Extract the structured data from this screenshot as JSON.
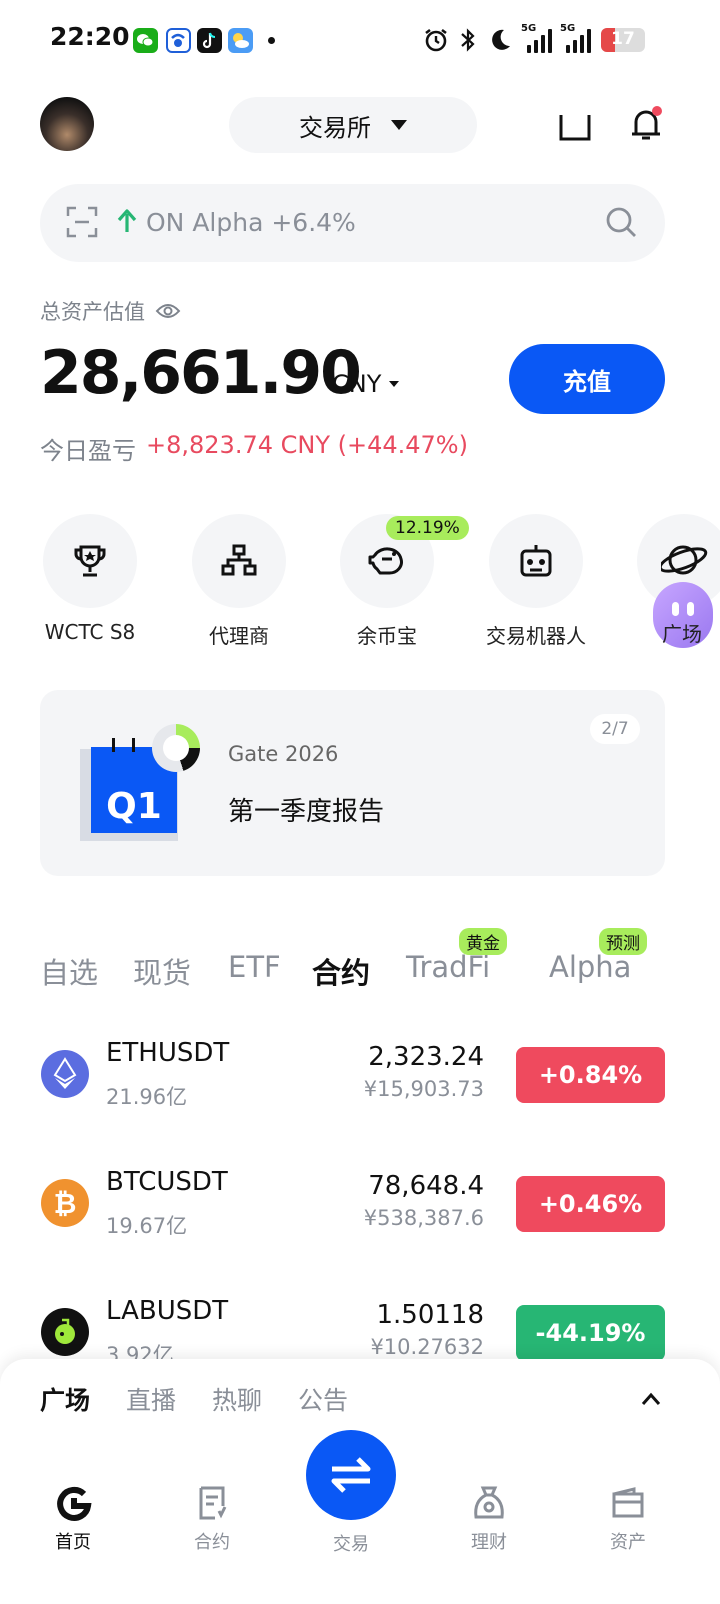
{
  "status_bar": {
    "time": "22:20",
    "battery": "17",
    "net1": "5G",
    "net2": "5G",
    "icons": [
      "wechat-icon",
      "app-icon",
      "tiktok-icon",
      "weather-icon",
      "alarm-icon",
      "bluetooth-icon",
      "moon-icon"
    ]
  },
  "header": {
    "exchange_label": "交易所",
    "icons": [
      "avatar",
      "square-icon",
      "bell-icon"
    ]
  },
  "search": {
    "text": "ON Alpha +6.4%"
  },
  "assets": {
    "label": "总资产估值",
    "value": "28,661.90",
    "unit": "CNY",
    "deposit_label": "充值",
    "pnl_label": "今日盈亏",
    "pnl_value": "+8,823.74 CNY (+44.47%)"
  },
  "shortcuts": [
    {
      "label": "WCTC S8",
      "icon": "trophy-icon"
    },
    {
      "label": "代理商",
      "icon": "org-chart-icon"
    },
    {
      "label": "余币宝",
      "icon": "piggy-bank-icon",
      "badge": "12.19%"
    },
    {
      "label": "交易机器人",
      "icon": "robot-icon"
    },
    {
      "label": "广场",
      "icon": "planet-icon"
    }
  ],
  "banner": {
    "badge": "Q1",
    "subtitle": "Gate 2026",
    "title": "第一季度报告",
    "page": "2/7"
  },
  "market_tabs": [
    {
      "label": "自选"
    },
    {
      "label": "现货"
    },
    {
      "label": "ETF"
    },
    {
      "label": "合约",
      "active": true
    },
    {
      "label": "TradFi",
      "badge": "黄金"
    },
    {
      "label": "Alpha",
      "badge": "预测"
    }
  ],
  "markets": [
    {
      "symbol": "ETHUSDT",
      "volume": "21.96亿",
      "price": "2,323.24",
      "fiat": "¥15,903.73",
      "change": "+0.84%",
      "direction": "up"
    },
    {
      "symbol": "BTCUSDT",
      "volume": "19.67亿",
      "price": "78,648.4",
      "fiat": "¥538,387.6",
      "change": "+0.46%",
      "direction": "up"
    },
    {
      "symbol": "LABUSDT",
      "volume": "3.92亿",
      "price": "1.50118",
      "fiat": "¥10.27632",
      "change": "-44.19%",
      "direction": "down"
    }
  ],
  "feed_tabs": [
    {
      "label": "广场",
      "active": true
    },
    {
      "label": "直播"
    },
    {
      "label": "热聊"
    },
    {
      "label": "公告"
    }
  ],
  "bottom_nav": [
    {
      "label": "首页",
      "icon": "home-icon",
      "active": true
    },
    {
      "label": "合约",
      "icon": "contract-icon"
    },
    {
      "label": "交易",
      "icon": "swap-icon"
    },
    {
      "label": "理财",
      "icon": "finance-icon"
    },
    {
      "label": "资产",
      "icon": "wallet-icon"
    }
  ],
  "colors": {
    "accent": "#0a58f5",
    "up": "#ef4a5e",
    "down": "#27b674",
    "badge": "#a8ec5c"
  }
}
